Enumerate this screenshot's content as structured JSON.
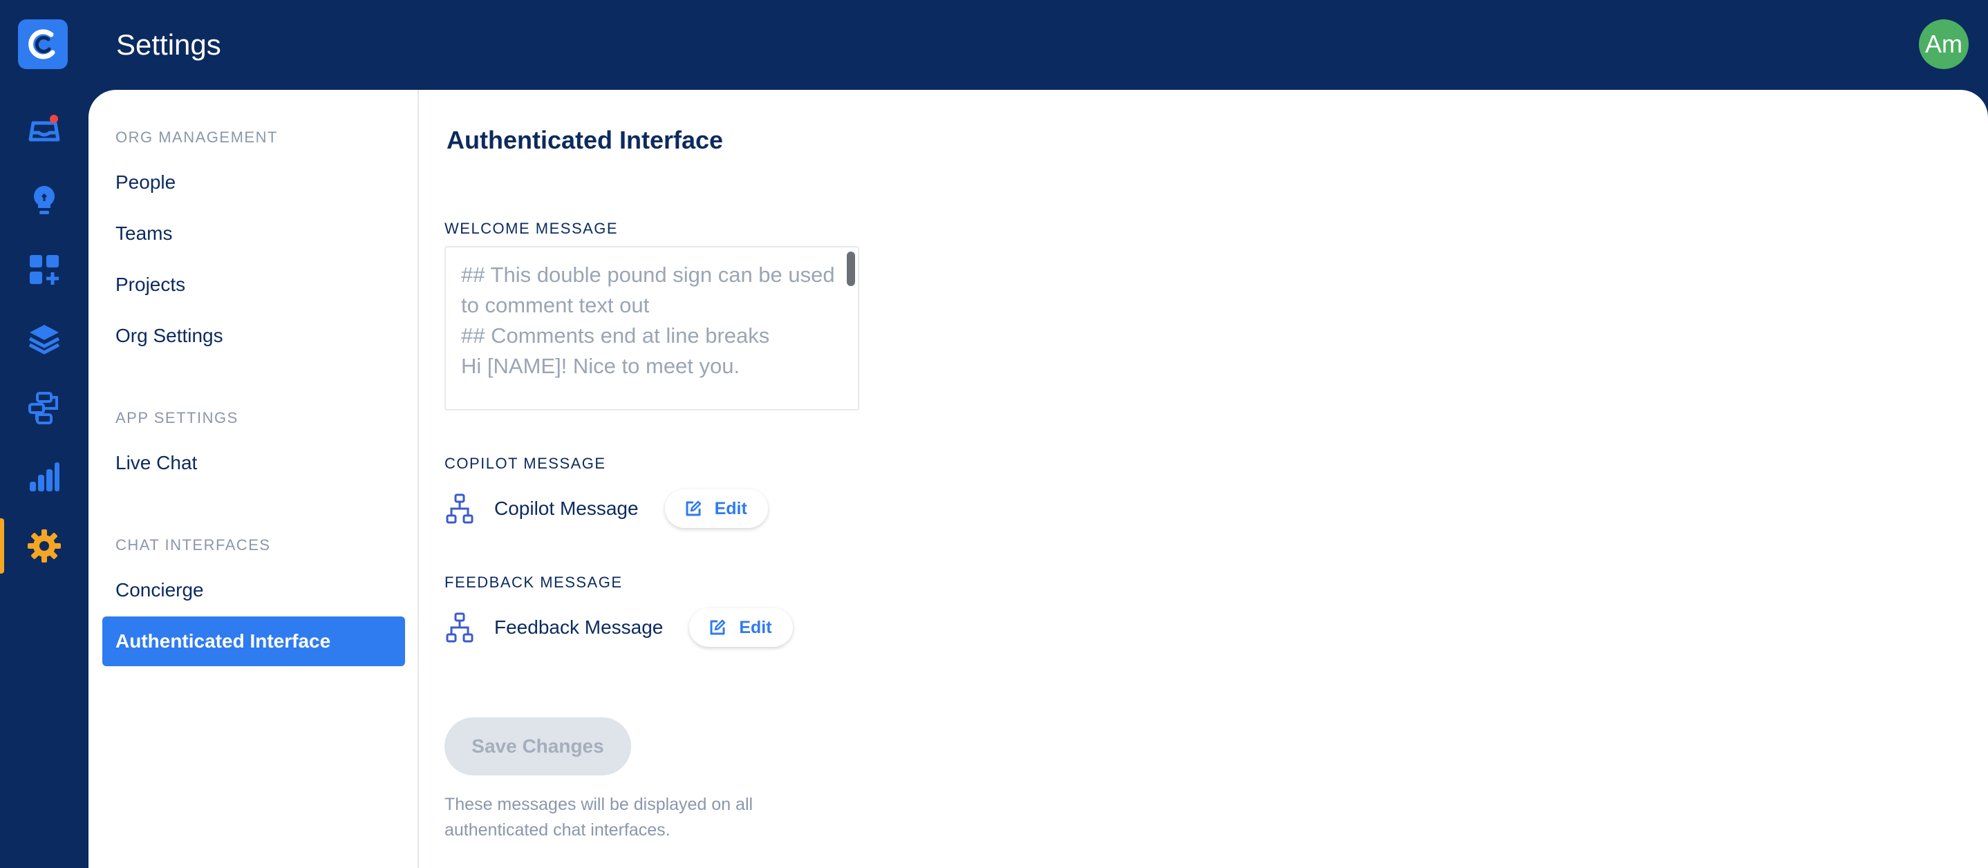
{
  "header": {
    "title": "Settings",
    "avatar_initials": "Am"
  },
  "rail": {
    "items": [
      {
        "icon": "inbox-icon"
      },
      {
        "icon": "lightbulb-icon"
      },
      {
        "icon": "add-widget-icon"
      },
      {
        "icon": "layers-icon"
      },
      {
        "icon": "integrations-icon"
      },
      {
        "icon": "analytics-icon"
      },
      {
        "icon": "gear-icon",
        "active": true
      }
    ]
  },
  "subnav": {
    "sections": [
      {
        "label": "ORG MANAGEMENT",
        "items": [
          "People",
          "Teams",
          "Projects",
          "Org Settings"
        ]
      },
      {
        "label": "APP SETTINGS",
        "items": [
          "Live Chat"
        ]
      },
      {
        "label": "CHAT INTERFACES",
        "items": [
          "Concierge",
          "Authenticated Interface"
        ]
      }
    ],
    "active_item": "Authenticated Interface"
  },
  "main": {
    "title": "Authenticated Interface",
    "welcome": {
      "label": "WELCOME MESSAGE",
      "value": "## This double pound sign can be used to comment text out\n## Comments end at line breaks\nHi [NAME]! Nice to meet you."
    },
    "copilot": {
      "label": "COPILOT MESSAGE",
      "name": "Copilot Message",
      "edit_label": "Edit"
    },
    "feedback": {
      "label": "FEEDBACK MESSAGE",
      "name": "Feedback Message",
      "edit_label": "Edit"
    },
    "save_label": "Save Changes",
    "hint": "These messages will be displayed on all authenticated chat interfaces."
  },
  "colors": {
    "navy": "#0b2a5f",
    "accent": "#2f7bf0",
    "active_rail": "#f5a623",
    "avatar": "#4caf63"
  }
}
